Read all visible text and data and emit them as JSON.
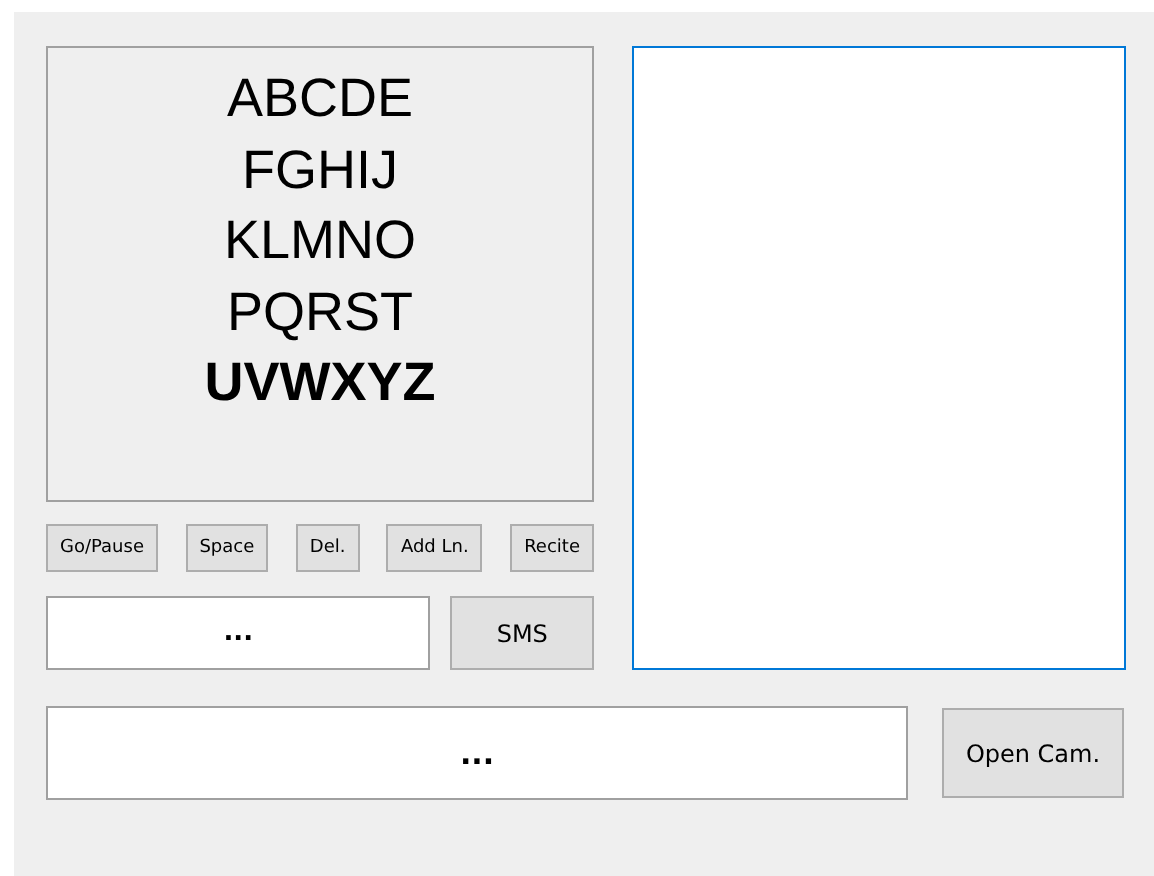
{
  "letter_rows": [
    {
      "text": "ABCDE",
      "selected": false
    },
    {
      "text": "FGHIJ",
      "selected": false
    },
    {
      "text": "KLMNO",
      "selected": false
    },
    {
      "text": "PQRST",
      "selected": false
    },
    {
      "text": "UVWXYZ",
      "selected": true
    }
  ],
  "buttons": [
    "Go/Pause",
    "Space",
    "Del.",
    "Add Ln.",
    "Recite"
  ],
  "message_field": {
    "value": "..."
  },
  "sms_button": "SMS",
  "output_area": {
    "focused": true
  },
  "bottom_field": {
    "value": "..."
  },
  "camera_button": "Open Cam."
}
